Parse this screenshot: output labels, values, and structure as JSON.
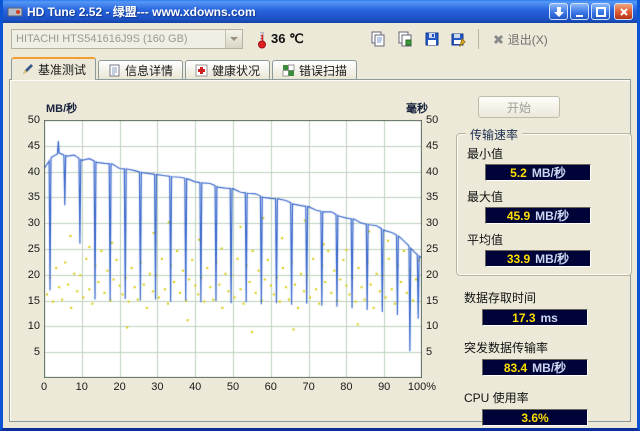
{
  "window": {
    "title": "HD Tune 2.52 - 绿盟--- www.xdowns.com"
  },
  "titlebar": {
    "icons": [
      "download-icon",
      "minimize-icon",
      "maximize-icon",
      "close-icon"
    ]
  },
  "toolbar": {
    "drive_select": {
      "value": "HITACHI HTS541616J9S (160 GB)"
    },
    "temperature": {
      "value": "36",
      "unit": "℃",
      "icon": "thermometer-icon"
    },
    "tool_buttons": [
      "copy-icon",
      "copy-image-icon",
      "save-icon",
      "save-image-icon"
    ],
    "exit_label": "退出(X)"
  },
  "tabs": [
    {
      "label": "基准测试",
      "icon": "pen-icon",
      "active": true
    },
    {
      "label": "信息详情",
      "icon": "info-icon",
      "active": false
    },
    {
      "label": "健康状况",
      "icon": "health-icon",
      "active": false
    },
    {
      "label": "错误扫描",
      "icon": "scan-icon",
      "active": false
    }
  ],
  "benchmark": {
    "start_button": "开始",
    "transfer_group_title": "传输速率",
    "stats": [
      {
        "label": "最小值",
        "value": "5.2",
        "unit": "MB/秒"
      },
      {
        "label": "最大值",
        "value": "45.9",
        "unit": "MB/秒"
      },
      {
        "label": "平均值",
        "value": "33.9",
        "unit": "MB/秒"
      }
    ],
    "extra_stats": [
      {
        "label": "数据存取时间",
        "value": "17.3",
        "unit": "ms"
      },
      {
        "label": "突发数据传输率",
        "value": "83.4",
        "unit": "MB/秒"
      },
      {
        "label": "CPU 使用率",
        "value": "3.6%",
        "unit": ""
      }
    ]
  },
  "chart_data": {
    "type": "line+scatter",
    "title": "",
    "grid": true,
    "grid_color": "#bed2be",
    "border_color": "#5a6a5a",
    "left_axis": {
      "label": "MB/秒",
      "min": 0,
      "max": 50,
      "step": 5
    },
    "right_axis": {
      "label": "毫秒",
      "min": 0,
      "max": 50,
      "step": 5
    },
    "x_axis": {
      "min": 0,
      "max": 100,
      "step": 10,
      "last_label": "100%"
    },
    "transfer_rate": {
      "name": "传输速率",
      "color": "#3565cc",
      "points": [
        [
          0,
          40.5
        ],
        [
          2,
          42.8
        ],
        [
          4,
          43.6
        ],
        [
          6,
          43
        ],
        [
          8,
          43.2
        ],
        [
          10,
          42.2
        ],
        [
          12,
          42.5
        ],
        [
          14,
          41.8
        ],
        [
          16,
          41.6
        ],
        [
          18,
          41.5
        ],
        [
          20,
          40.6
        ],
        [
          22,
          40.5
        ],
        [
          24,
          40.2
        ],
        [
          26,
          39.8
        ],
        [
          28,
          39.6
        ],
        [
          30,
          39.4
        ],
        [
          32,
          39.2
        ],
        [
          34,
          39
        ],
        [
          36,
          38.9
        ],
        [
          38,
          38.6
        ],
        [
          40,
          38
        ],
        [
          42,
          37.8
        ],
        [
          44,
          37.7
        ],
        [
          46,
          37
        ],
        [
          48,
          36.8
        ],
        [
          50,
          36.7
        ],
        [
          52,
          36
        ],
        [
          54,
          35.8
        ],
        [
          56,
          35.7
        ],
        [
          58,
          35
        ],
        [
          60,
          34.8
        ],
        [
          62,
          34.7
        ],
        [
          64,
          34.4
        ],
        [
          66,
          33.7
        ],
        [
          68,
          33.4
        ],
        [
          70,
          33.2
        ],
        [
          72,
          32.5
        ],
        [
          74,
          32.2
        ],
        [
          76,
          32.2
        ],
        [
          78,
          31.4
        ],
        [
          80,
          31
        ],
        [
          82,
          30.8
        ],
        [
          84,
          30
        ],
        [
          86,
          29.7
        ],
        [
          88,
          29.5
        ],
        [
          90,
          28.6
        ],
        [
          92,
          28.2
        ],
        [
          94,
          27.4
        ],
        [
          96,
          26
        ],
        [
          98,
          24.4
        ],
        [
          100,
          23.2
        ]
      ],
      "spikes": [
        [
          1.6,
          17
        ],
        [
          3.8,
          45.9
        ],
        [
          5.5,
          33.5
        ],
        [
          9.5,
          26
        ],
        [
          13.5,
          15.2
        ],
        [
          17.5,
          15
        ],
        [
          21.5,
          15.3
        ],
        [
          25.5,
          15
        ],
        [
          29.5,
          15.2
        ],
        [
          33.5,
          14.8
        ],
        [
          37.5,
          15
        ],
        [
          41.5,
          14.7
        ],
        [
          45.5,
          14.9
        ],
        [
          49.5,
          14.5
        ],
        [
          53.5,
          14.7
        ],
        [
          57.5,
          14.3
        ],
        [
          61.5,
          14.5
        ],
        [
          65.5,
          14.2
        ],
        [
          69.5,
          14.4
        ],
        [
          73.5,
          14
        ],
        [
          77.5,
          13.8
        ],
        [
          81.5,
          13.5
        ],
        [
          85.5,
          13.2
        ],
        [
          89.5,
          12.8
        ],
        [
          93.5,
          12.2
        ],
        [
          96.8,
          5.2
        ],
        [
          99,
          11.5
        ]
      ]
    },
    "access_time": {
      "name": "存取时间",
      "color": "#d8ca00",
      "points": [
        [
          0.8,
          16.2
        ],
        [
          1.6,
          19.4
        ],
        [
          2.4,
          14.8
        ],
        [
          3.2,
          21.3
        ],
        [
          4,
          17.6
        ],
        [
          4.8,
          15.2
        ],
        [
          5.6,
          22.4
        ],
        [
          6.4,
          18.1
        ],
        [
          7.2,
          13.6
        ],
        [
          8,
          20.2
        ],
        [
          8.8,
          16.8
        ],
        [
          9.6,
          19.9
        ],
        [
          10.4,
          15.6
        ],
        [
          11.2,
          23.1
        ],
        [
          12,
          17.2
        ],
        [
          12.8,
          14.4
        ],
        [
          13.6,
          21.8
        ],
        [
          14.4,
          18.6
        ],
        [
          15.2,
          24.6
        ],
        [
          16,
          16.5
        ],
        [
          16.8,
          20.8
        ],
        [
          17.6,
          15
        ],
        [
          18.4,
          19.1
        ],
        [
          19.2,
          22.9
        ],
        [
          20,
          17.9
        ],
        [
          20.8,
          16.2
        ],
        [
          21.6,
          19.4
        ],
        [
          22.4,
          14.8
        ],
        [
          23.2,
          21.3
        ],
        [
          24,
          17.6
        ],
        [
          24.8,
          15.2
        ],
        [
          25.6,
          22.4
        ],
        [
          26.4,
          18.1
        ],
        [
          27.2,
          13.6
        ],
        [
          28,
          20.2
        ],
        [
          28.8,
          16.8
        ],
        [
          29.6,
          19.9
        ],
        [
          30.4,
          15.6
        ],
        [
          31.2,
          23.1
        ],
        [
          32,
          17.2
        ],
        [
          32.8,
          14.4
        ],
        [
          33.6,
          21.8
        ],
        [
          34.4,
          18.6
        ],
        [
          35.2,
          24.6
        ],
        [
          36,
          16.5
        ],
        [
          36.8,
          20.8
        ],
        [
          37.6,
          15
        ],
        [
          38.4,
          19.1
        ],
        [
          39.2,
          22.9
        ],
        [
          40,
          17.9
        ],
        [
          40.8,
          16.2
        ],
        [
          41.6,
          19.4
        ],
        [
          42.4,
          14.8
        ],
        [
          43.2,
          21.3
        ],
        [
          44,
          17.6
        ],
        [
          44.8,
          15.2
        ],
        [
          45.6,
          22.4
        ],
        [
          46.4,
          18.1
        ],
        [
          47.2,
          13.6
        ],
        [
          48,
          20.2
        ],
        [
          48.8,
          16.8
        ],
        [
          49.6,
          19.9
        ],
        [
          50.4,
          15.6
        ],
        [
          51.2,
          23.1
        ],
        [
          52,
          17.2
        ],
        [
          52.8,
          14.4
        ],
        [
          53.6,
          21.8
        ],
        [
          54.4,
          18.6
        ],
        [
          55.2,
          24.6
        ],
        [
          56,
          16.5
        ],
        [
          56.8,
          20.8
        ],
        [
          57.6,
          15
        ],
        [
          58.4,
          19.1
        ],
        [
          59.2,
          22.9
        ],
        [
          60,
          17.9
        ],
        [
          60.8,
          16.2
        ],
        [
          61.6,
          19.4
        ],
        [
          62.4,
          14.8
        ],
        [
          63.2,
          21.3
        ],
        [
          64,
          17.6
        ],
        [
          64.8,
          15.2
        ],
        [
          65.6,
          22.4
        ],
        [
          66.4,
          18.1
        ],
        [
          67.2,
          13.6
        ],
        [
          68,
          20.2
        ],
        [
          68.8,
          16.8
        ],
        [
          69.6,
          19.9
        ],
        [
          70.4,
          15.6
        ],
        [
          71.2,
          23.1
        ],
        [
          72,
          17.2
        ],
        [
          72.8,
          14.4
        ],
        [
          73.6,
          21.8
        ],
        [
          74.4,
          18.6
        ],
        [
          75.2,
          24.6
        ],
        [
          76,
          16.5
        ],
        [
          76.8,
          20.8
        ],
        [
          77.6,
          15
        ],
        [
          78.4,
          19.1
        ],
        [
          79.2,
          22.9
        ],
        [
          80,
          17.9
        ],
        [
          80.8,
          16.2
        ],
        [
          81.6,
          19.4
        ],
        [
          82.4,
          14.8
        ],
        [
          83.2,
          21.3
        ],
        [
          84,
          17.6
        ],
        [
          84.8,
          15.2
        ],
        [
          85.6,
          22.4
        ],
        [
          86.4,
          18.1
        ],
        [
          87.2,
          13.6
        ],
        [
          88,
          20.2
        ],
        [
          88.8,
          16.8
        ],
        [
          89.6,
          19.9
        ],
        [
          90.4,
          15.6
        ],
        [
          91.2,
          23.1
        ],
        [
          92,
          17.2
        ],
        [
          92.8,
          14.4
        ],
        [
          93.6,
          21.8
        ],
        [
          94.4,
          18.6
        ],
        [
          95.2,
          24.6
        ],
        [
          96,
          16.5
        ],
        [
          96.8,
          20.8
        ],
        [
          97.6,
          15
        ],
        [
          98.4,
          19.1
        ],
        [
          99.2,
          22.9
        ],
        [
          7,
          27.5
        ],
        [
          18,
          26.2
        ],
        [
          29,
          28.1
        ],
        [
          41,
          26.8
        ],
        [
          52,
          29.3
        ],
        [
          63,
          27.1
        ],
        [
          74,
          25.9
        ],
        [
          86,
          28.4
        ],
        [
          33,
          30.2
        ],
        [
          58,
          31
        ],
        [
          12,
          25.4
        ],
        [
          91,
          26.6
        ],
        [
          47,
          25.1
        ],
        [
          69,
          30.5
        ],
        [
          80,
          24.8
        ],
        [
          22,
          9.8
        ],
        [
          55,
          8.9
        ],
        [
          83,
          10.4
        ],
        [
          38,
          11.2
        ],
        [
          66,
          9.4
        ]
      ]
    }
  }
}
